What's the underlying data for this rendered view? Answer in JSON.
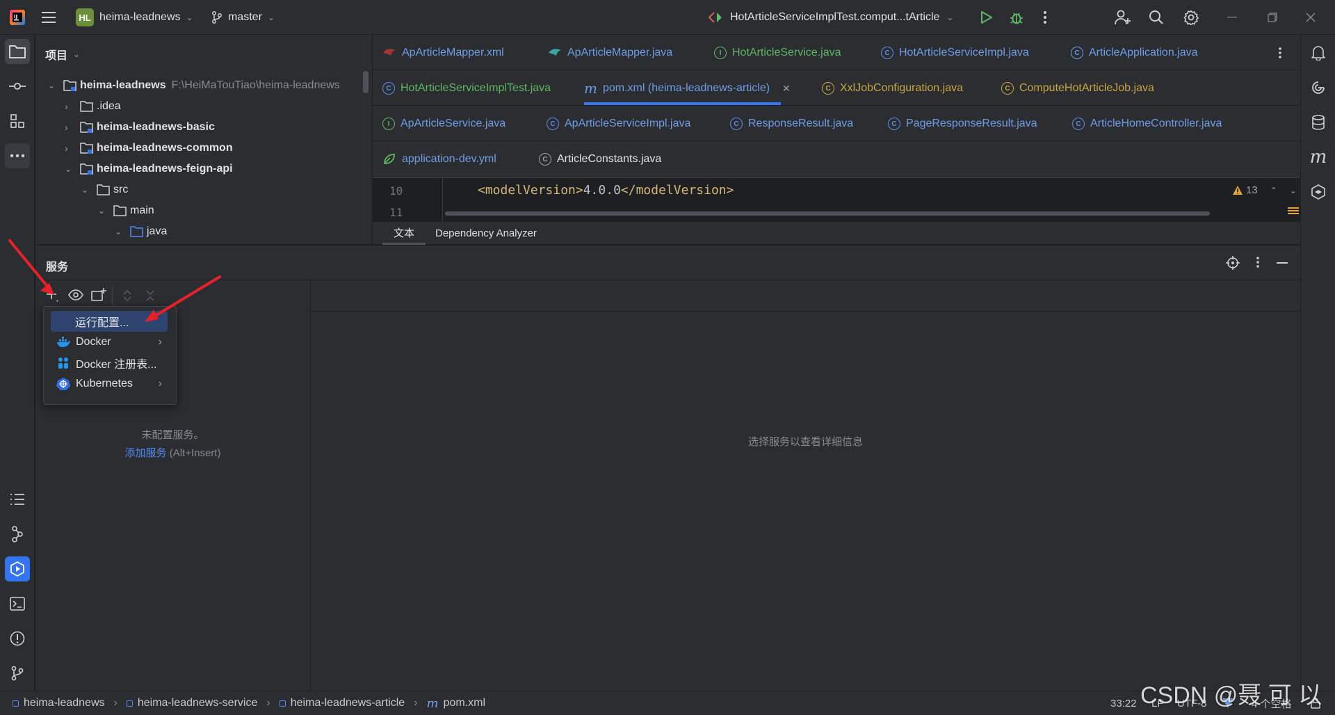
{
  "titlebar": {
    "project_badge": "HL",
    "project_name": "heima-leadnews",
    "branch": "master",
    "run_config": "HotArticleServiceImplTest.comput...tArticle"
  },
  "project_panel": {
    "title": "项目",
    "tree": [
      {
        "label": "heima-leadnews",
        "path": "F:\\HeiMaTouTiao\\heima-leadnews",
        "bold": true
      },
      {
        "label": ".idea"
      },
      {
        "label": "heima-leadnews-basic",
        "bold": true
      },
      {
        "label": "heima-leadnews-common",
        "bold": true
      },
      {
        "label": "heima-leadnews-feign-api",
        "bold": true
      },
      {
        "label": "src"
      },
      {
        "label": "main"
      },
      {
        "label": "java"
      }
    ]
  },
  "editor": {
    "tabs_row1": [
      "ApArticleMapper.xml",
      "ApArticleMapper.java",
      "HotArticleService.java",
      "HotArticleServiceImpl.java",
      "ArticleApplication.java"
    ],
    "tabs_row2": [
      "HotArticleServiceImplTest.java",
      "pom.xml (heima-leadnews-article)",
      "XxlJobConfiguration.java",
      "ComputeHotArticleJob.java"
    ],
    "tabs_row3": [
      "ApArticleService.java",
      "ApArticleServiceImpl.java",
      "ResponseResult.java",
      "PageResponseResult.java",
      "ArticleHomeController.java"
    ],
    "tabs_row4": [
      "application-dev.yml",
      "ArticleConstants.java"
    ],
    "active_tab_prefix": "m",
    "line_numbers": [
      "10",
      "11"
    ],
    "code_line": {
      "open_tag": "<modelVersion>",
      "value": "4.0.0",
      "close_tag": "</modelVersion>"
    },
    "warning_count": "13",
    "bottom_tabs": [
      "文本",
      "Dependency Analyzer"
    ]
  },
  "services": {
    "title": "服务",
    "empty_text": "未配置服务。",
    "add_link": "添加服务",
    "add_shortcut": "(Alt+Insert)",
    "detail_placeholder": "选择服务以查看详细信息",
    "menu": [
      {
        "label": "运行配置...",
        "selected": true
      },
      {
        "label": "Docker",
        "submenu": true
      },
      {
        "label": "Docker 注册表..."
      },
      {
        "label": "Kubernetes",
        "submenu": true
      }
    ]
  },
  "statusbar": {
    "breadcrumbs": [
      "heima-leadnews",
      "heima-leadnews-service",
      "heima-leadnews-article",
      "pom.xml"
    ],
    "position": "33:22",
    "line_sep": "LF",
    "encoding": "UTF-8",
    "indent": "4 个空格"
  },
  "watermark": "CSDN @聂 可 以",
  "colors": {
    "accent": "#3574f0",
    "selection": "#2e436e",
    "arrow": "#e8202a",
    "xml_tag": "#d5b778",
    "link": "#548af7"
  }
}
